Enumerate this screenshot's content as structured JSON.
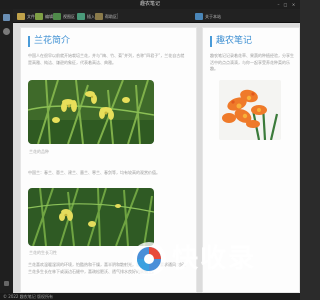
{
  "window": {
    "title": "趣农笔记"
  },
  "toolbar": {
    "items": [
      {
        "label": "文件",
        "icon": "folder-icon",
        "color": "#c0a24a"
      },
      {
        "label": "编辑",
        "icon": "edit-icon",
        "color": "#7fa045"
      },
      {
        "label": "视图区",
        "icon": "view-icon",
        "color": "#4f8a4a"
      },
      {
        "label": "插入",
        "icon": "insert-icon",
        "color": "#4a9a7a"
      },
      {
        "label": "帮助区",
        "icon": "help-icon",
        "color": "#8a7a4a"
      },
      {
        "label": "关于本站",
        "icon": "info-icon",
        "color": "#4a86b8"
      }
    ]
  },
  "sidebar": {
    "icons": [
      "notes-icon",
      "user-icon",
      "settings-icon"
    ]
  },
  "left_page": {
    "title": "兰花简介",
    "intro": "中国人在很早以前就开始栽培兰花，并与“梅、竹、菊”并列，合称“四君子”，兰花自古就是高雅、纯洁、谦逊的象征，代表着高洁、典雅。",
    "caption1": "兰花的品种",
    "varieties": "中国兰：春兰、蕙兰、建兰、墨兰、寒兰、春剑等，均有较高的观赏价值。",
    "caption2": "兰花的生长习性",
    "habit": "兰花喜欢温暖湿润的环境，怕酷热和干燥，喜半阴和散射光，忌阳光直射；要求通风良好；兰花多生长在林下或溪边石缝中，喜疏松肥沃、透气排水良好的腐殖土。"
  },
  "right_page": {
    "title": "趣农笔记",
    "intro": "趣农笔记记录着花草、果蔬的种植经验，分享生活中的点点滴滴，与你一起享受养花种菜的乐趣。"
  },
  "statusbar": {
    "text": "© 2022 趣农笔记 版权所有"
  },
  "watermark": {
    "text": "快收录"
  },
  "colors": {
    "accent": "#3d8fd2",
    "title_bar": "#1e1e1e",
    "page_bg": "#fdfdfd"
  }
}
